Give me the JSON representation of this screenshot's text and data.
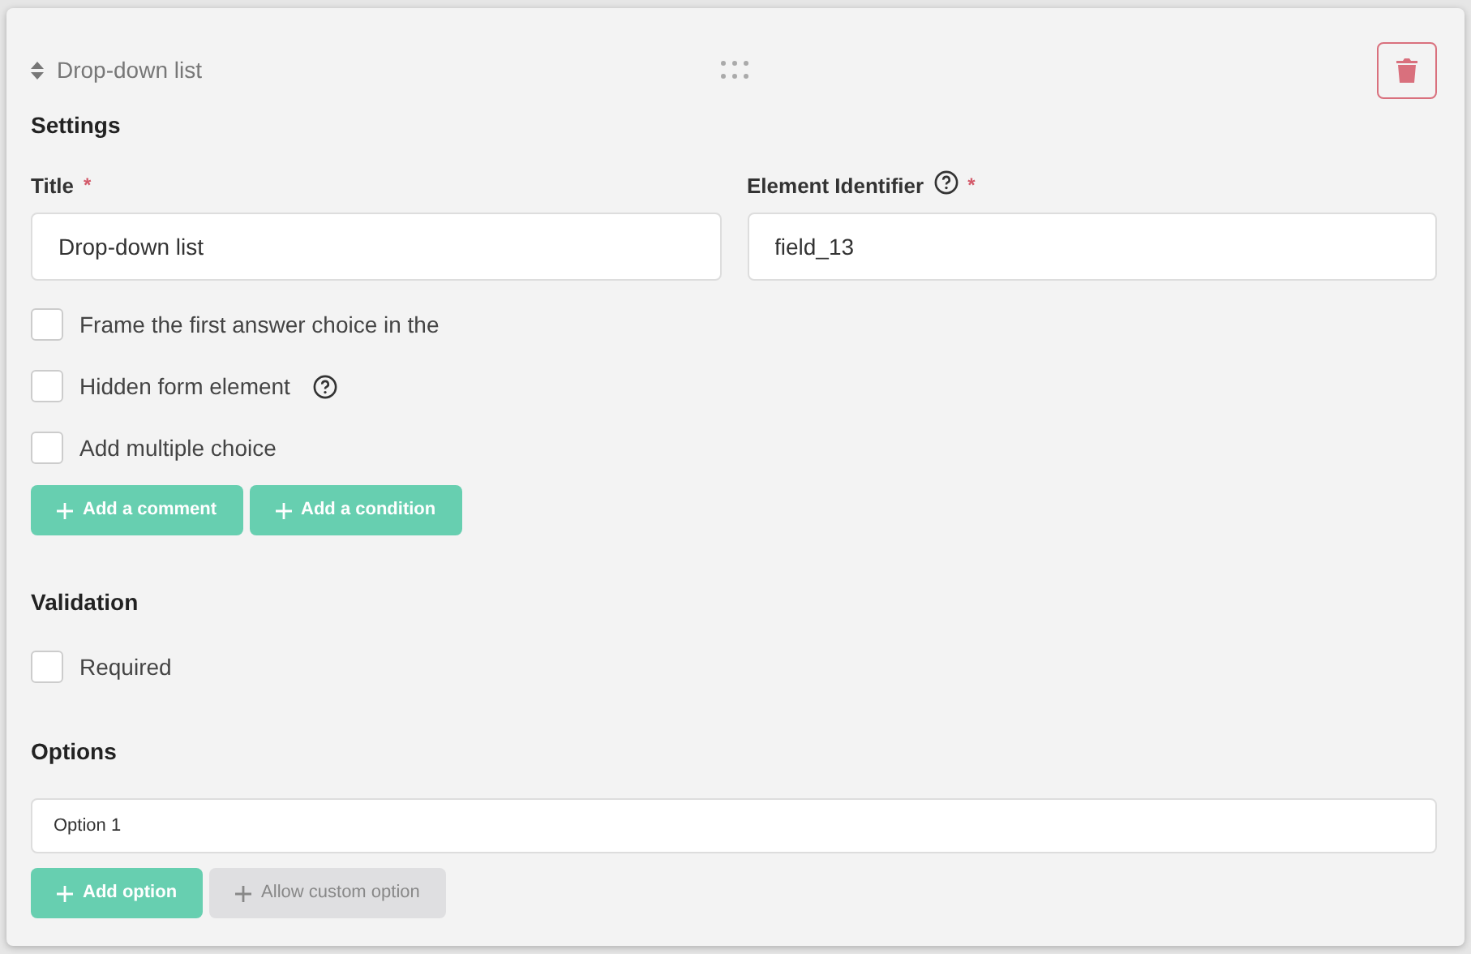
{
  "header": {
    "title": "Drop-down list"
  },
  "settings": {
    "heading": "Settings",
    "fields": [
      {
        "label": "Title",
        "required_mark": "*",
        "help": false,
        "value": "Drop-down list"
      },
      {
        "label": "Element Identifier",
        "required_mark": "*",
        "help": true,
        "value": "field_13"
      }
    ],
    "checkboxes": [
      {
        "label": "Frame the first answer choice in the",
        "checked": false,
        "help": false
      },
      {
        "label": "Hidden form element",
        "checked": false,
        "help": true
      },
      {
        "label": "Add multiple choice",
        "checked": false,
        "help": false
      }
    ],
    "buttons": [
      {
        "label": "Add a comment",
        "kind": "primary"
      },
      {
        "label": "Add a condition",
        "kind": "primary"
      }
    ]
  },
  "validation": {
    "heading": "Validation",
    "checkboxes": [
      {
        "label": "Required",
        "checked": false,
        "help": false
      }
    ]
  },
  "options": {
    "heading": "Options",
    "items": [
      {
        "value": "Option 1"
      }
    ],
    "buttons": [
      {
        "label": "Add option",
        "kind": "primary"
      },
      {
        "label": "Allow custom option",
        "kind": "secondary"
      }
    ]
  }
}
